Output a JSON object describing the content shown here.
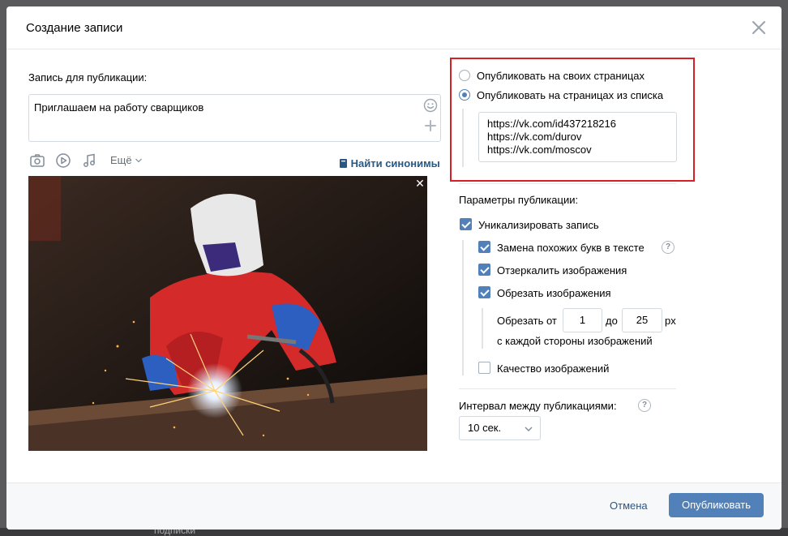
{
  "background": {
    "partial_text": "подписки"
  },
  "modal": {
    "title": "Создание записи",
    "post": {
      "section_label": "Запись для публикации:",
      "text": "Приглашаем на работу сварщиков",
      "more_label": "Ещё",
      "synonyms_label": "Найти синонимы",
      "photo_alt": "welder"
    },
    "publish_targets": {
      "option_own": "Опубликовать на своих страницах",
      "option_list": "Опубликовать на страницах из списка",
      "selected": "option_list",
      "urls": [
        "https://vk.com/id437218216",
        "https://vk.com/durov",
        "https://vk.com/moscov"
      ]
    },
    "params": {
      "section_label": "Параметры публикации:",
      "unique_label": "Уникализировать запись",
      "unique_checked": true,
      "replace_letters_label": "Замена похожих букв в тексте",
      "replace_letters_checked": true,
      "mirror_label": "Отзеркалить изображения",
      "mirror_checked": true,
      "crop_label": "Обрезать изображения",
      "crop_checked": true,
      "crop_from_label": "Обрезать от",
      "crop_from_value": "1",
      "crop_to_label": "до",
      "crop_to_value": "25",
      "crop_unit": "px",
      "crop_note": "с каждой стороны изображений",
      "quality_label": "Качество изображений",
      "quality_checked": false,
      "help_glyph": "?"
    },
    "interval": {
      "label": "Интервал между публикациями:",
      "value": "10 сек."
    },
    "footer": {
      "cancel": "Отмена",
      "publish": "Опубликовать"
    }
  },
  "colors": {
    "accent": "#5181b8",
    "link": "#2a5885",
    "highlight_border": "#d81f26"
  }
}
